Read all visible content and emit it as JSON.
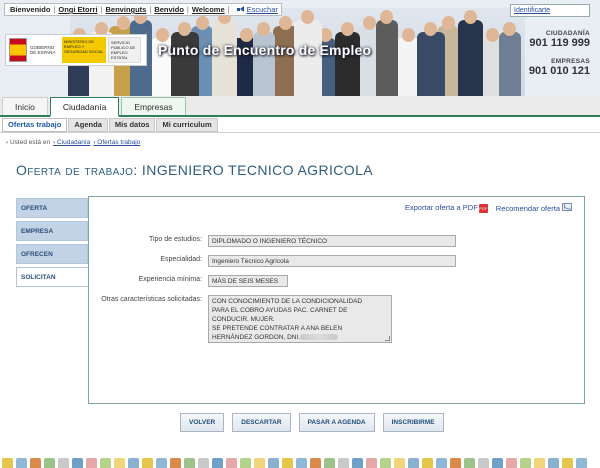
{
  "header": {
    "languages": [
      "Bienvenido",
      "Ongi Etorri",
      "Benvinguts",
      "Benvido",
      "Welcome"
    ],
    "listen_label": "Escuchar",
    "identify_label": "Identificarte",
    "portal_title": "Punto de Encuentro de Empleo",
    "gov_logo": {
      "gov_text": "GOBIERNO DE ESPAÑA",
      "ministry_text": "MINISTERIO DE EMPLEO Y SEGURIDAD SOCIAL",
      "spe_text": "SERVICIO PÚBLICO DE EMPLEO ESTATAL"
    },
    "phones": [
      {
        "label": "CIUDADANÍA",
        "number": "901 119 999"
      },
      {
        "label": "EMPRESAS",
        "number": "901 010 121"
      }
    ]
  },
  "main_nav": {
    "tabs": [
      "Inicio",
      "Ciudadanía",
      "Empresas"
    ],
    "active": "Ciudadanía"
  },
  "sub_nav": {
    "tabs": [
      "Ofertas trabajo",
      "Agenda",
      "Mis datos",
      "Mi curriculum"
    ],
    "active": "Ofertas trabajo"
  },
  "breadcrumb": {
    "prefix": "› Usted está en",
    "items": [
      "› Ciudadanía",
      "› Ofertas trabajo"
    ]
  },
  "page": {
    "title_prefix": "Oferta de trabajo:",
    "title_main": "INGENIERO TECNICO AGRICOLA"
  },
  "left_nav": {
    "items": [
      "OFERTA",
      "EMPRESA",
      "OFRECEN",
      "SOLICITAN"
    ],
    "active": "SOLICITAN"
  },
  "panel": {
    "export_pdf_label": "Exportar oferta a PDF",
    "pdf_icon_text": "PDF",
    "recommend_label": "Recomendar oferta",
    "fields": [
      {
        "label": "Tipo de estudios:",
        "value": "DIPLOMADO O INGENIERO TÉCNICO"
      },
      {
        "label": "Especialidad:",
        "value": "Ingeniero Técnico Agrícola"
      },
      {
        "label": "Experiencia mínima:",
        "value": "MÁS DE SEIS MESES"
      },
      {
        "label": "Otras características solicitadas:",
        "value_lines": [
          "CON CONOCIMIENTO DE LA CONDICIONALIDAD",
          "PARA EL COBRO AYUDAS PAC. CARNET DE",
          "CONDUCIR. MUJER.",
          "SE PRETENDE CONTRATAR A ANA BELEN",
          "HERNÁNDEZ GORDON, DNI."
        ]
      }
    ]
  },
  "buttons": [
    "VOLVER",
    "DESCARTAR",
    "PASAR A AGENDA",
    "INSCRIBIRME"
  ],
  "colors": {
    "accent_green": "#2f7e5a",
    "title_blue": "#2f5d7e",
    "link_blue": "#2a4d9a",
    "left_nav_bg": "#c3d3e6",
    "panel_border": "#7aa3a1"
  }
}
